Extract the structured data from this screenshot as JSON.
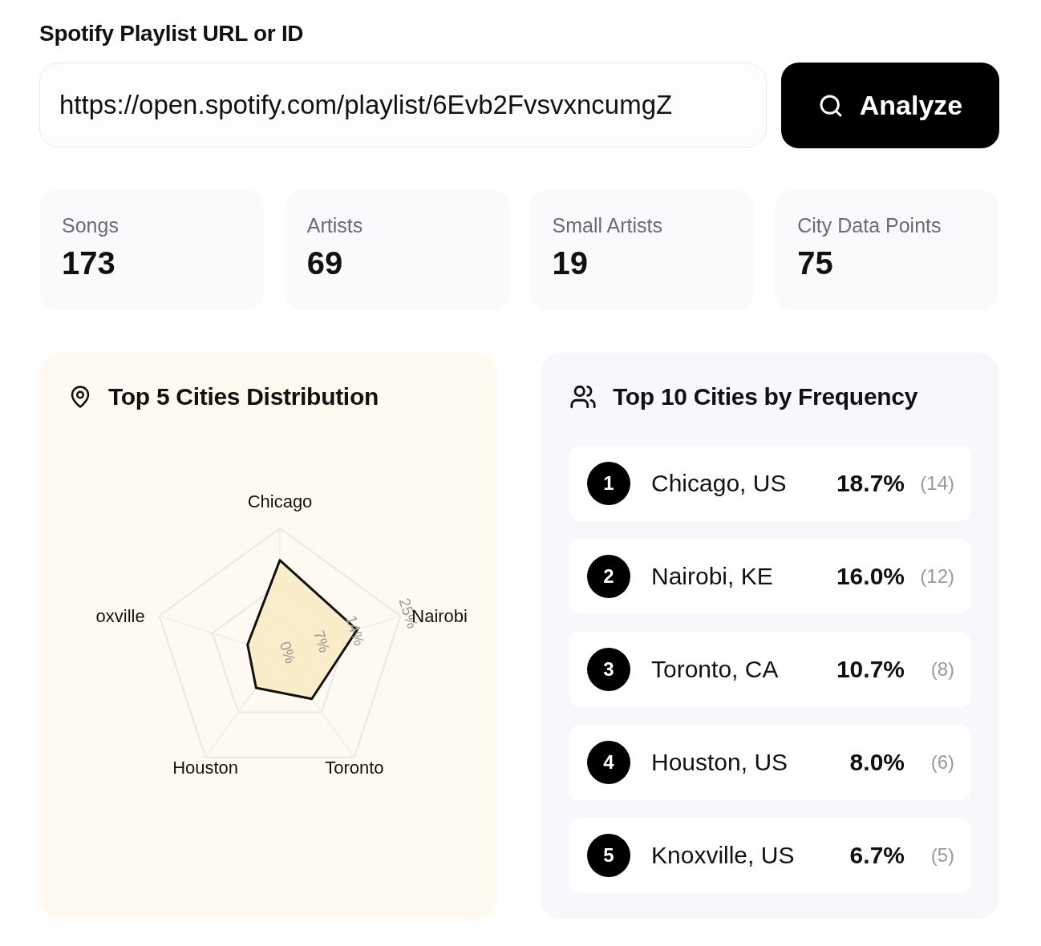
{
  "input": {
    "label": "Spotify Playlist URL or ID",
    "value": "https://open.spotify.com/playlist/6Evb2FvsvxncumgZ"
  },
  "analyze_button": {
    "label": "Analyze"
  },
  "stats": [
    {
      "label": "Songs",
      "value": "173"
    },
    {
      "label": "Artists",
      "value": "69"
    },
    {
      "label": "Small Artists",
      "value": "19"
    },
    {
      "label": "City Data Points",
      "value": "75"
    }
  ],
  "distribution": {
    "title": "Top 5 Cities Distribution",
    "chart_data": {
      "type": "radar",
      "categories": [
        "Chicago",
        "Nairobi",
        "Toronto",
        "Houston",
        "oxville"
      ],
      "values": [
        18.7,
        16.0,
        10.7,
        8.0,
        6.7
      ],
      "ylim": [
        0,
        25
      ],
      "yticks": [
        {
          "value": 0,
          "label": "0%"
        },
        {
          "value": 7,
          "label": "7%"
        },
        {
          "value": 14,
          "label": "14%"
        },
        {
          "value": 25,
          "label": "25%"
        }
      ]
    }
  },
  "top_cities": {
    "title": "Top 10 Cities by Frequency",
    "items": [
      {
        "rank": "1",
        "city": "Chicago, US",
        "percent": "18.7%",
        "count": "(14)"
      },
      {
        "rank": "2",
        "city": "Nairobi, KE",
        "percent": "16.0%",
        "count": "(12)"
      },
      {
        "rank": "3",
        "city": "Toronto, CA",
        "percent": "10.7%",
        "count": "(8)"
      },
      {
        "rank": "4",
        "city": "Houston, US",
        "percent": "8.0%",
        "count": "(6)"
      },
      {
        "rank": "5",
        "city": "Knoxville, US",
        "percent": "6.7%",
        "count": "(5)"
      }
    ]
  }
}
